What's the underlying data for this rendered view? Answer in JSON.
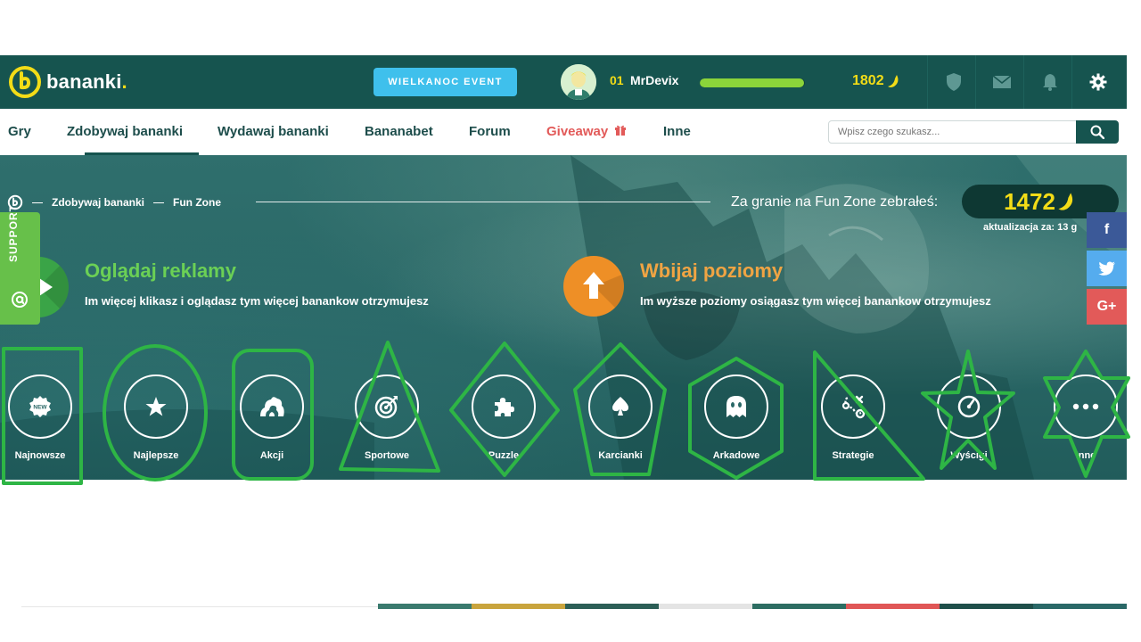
{
  "brand": {
    "name": "bananki",
    "dot": "."
  },
  "header": {
    "event_label": "WIELKANOC EVENT",
    "user_level": "01",
    "username": "MrDevix",
    "progress_fraction": 0.99,
    "balance": "1802"
  },
  "nav": {
    "items": [
      {
        "label": "Gry"
      },
      {
        "label": "Zdobywaj bananki"
      },
      {
        "label": "Wydawaj bananki"
      },
      {
        "label": "Bananabet"
      },
      {
        "label": "Forum"
      },
      {
        "label": "Giveaway"
      },
      {
        "label": "Inne"
      }
    ],
    "search_placeholder": "Wpisz czego szukasz..."
  },
  "breadcrumb": {
    "items": [
      "Zdobywaj bananki",
      "Fun Zone"
    ]
  },
  "funzone": {
    "label": "Za granie na Fun Zone zebrałeś:",
    "value": "1472",
    "update_text": "aktualizacja za: 13 g"
  },
  "features": {
    "ads": {
      "title": "Oglądaj reklamy",
      "desc": "Im więcej klikasz i oglądasz tym więcej banankow otrzymujesz"
    },
    "levels": {
      "title": "Wbijaj poziomy",
      "desc": "Im wyższe poziomy osiągasz tym więcej banankow otrzymujesz"
    }
  },
  "categories": [
    {
      "label": "Najnowsze",
      "icon": "new-badge-icon",
      "badge_text": "NEW"
    },
    {
      "label": "Najlepsze",
      "icon": "star-icon"
    },
    {
      "label": "Akcji",
      "icon": "explosion-icon"
    },
    {
      "label": "Sportowe",
      "icon": "target-icon"
    },
    {
      "label": "Puzzle",
      "icon": "puzzle-icon"
    },
    {
      "label": "Karcianki",
      "icon": "spade-icon"
    },
    {
      "label": "Arkadowe",
      "icon": "ghost-icon"
    },
    {
      "label": "Strategie",
      "icon": "strategy-icon"
    },
    {
      "label": "Wyścigi",
      "icon": "speedometer-icon"
    },
    {
      "label": "Inne",
      "icon": "more-icon"
    }
  ],
  "support": {
    "label": "SUPPORT"
  },
  "social": {
    "facebook": "f",
    "twitter": "twitter-bird-icon",
    "googleplus": "G+"
  },
  "colors": {
    "header_bg": "#16544f",
    "accent_yellow": "#f3dc17",
    "event_blue": "#3fc0ec",
    "green": "#67c04a",
    "orange": "#ee8f26",
    "annotation_green": "#2eb545",
    "facebook": "#3b5998",
    "twitter": "#55acee",
    "googleplus": "#e25a59"
  }
}
